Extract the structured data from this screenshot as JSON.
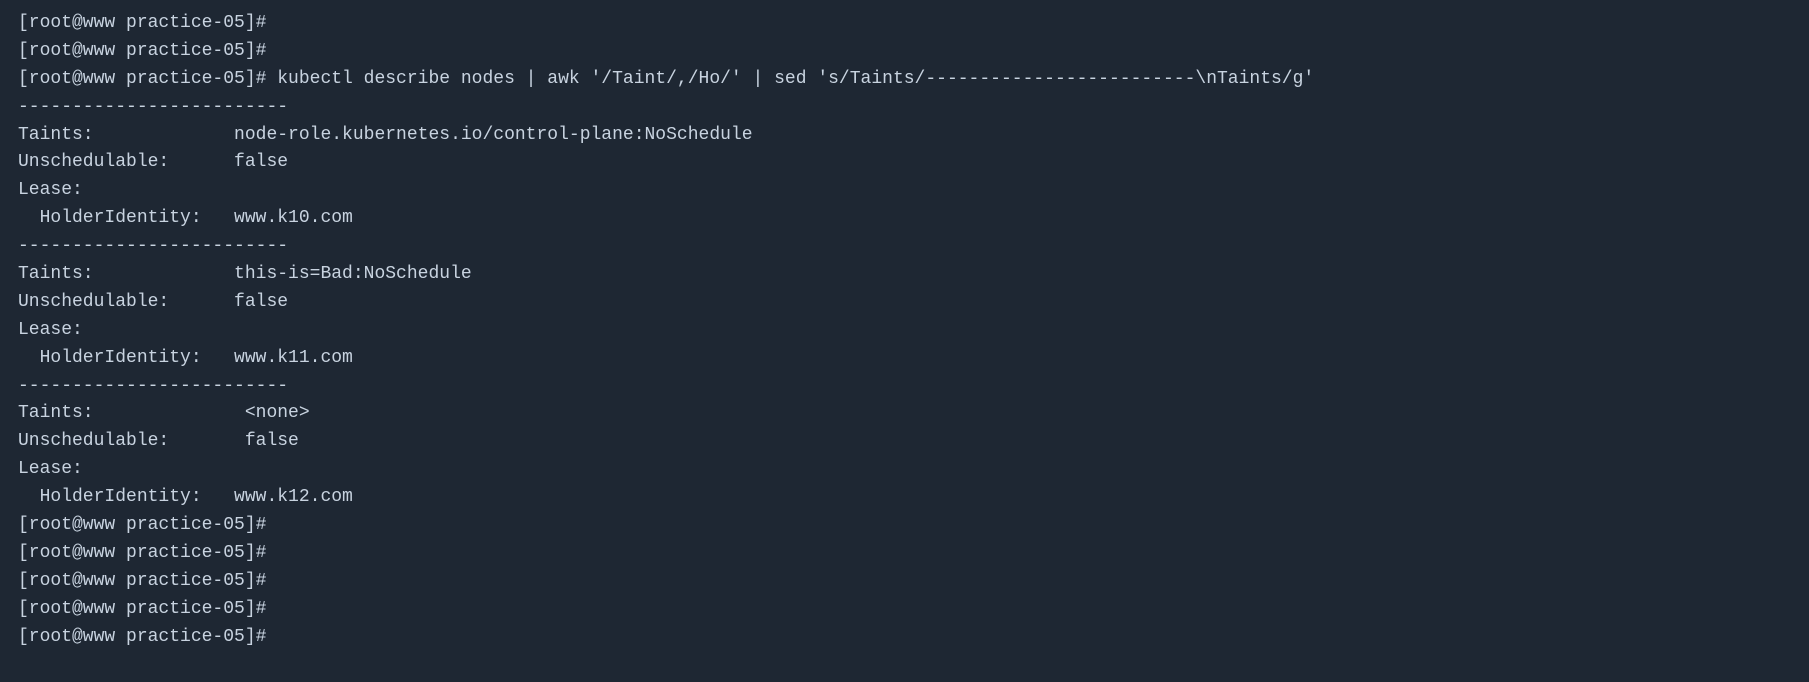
{
  "terminal": {
    "background": "#1e2733",
    "foreground": "#c8d3e0",
    "lines": [
      {
        "id": "line1",
        "text": "[root@www practice-05]#"
      },
      {
        "id": "line2",
        "text": "[root@www practice-05]#"
      },
      {
        "id": "line3",
        "text": "[root@www practice-05]# kubectl describe nodes | awk '/Taint/,/Ho/' | sed 's/Taints/-------------------------\\nTaints/g'"
      },
      {
        "id": "line4",
        "text": "-------------------------"
      },
      {
        "id": "line5",
        "text": "Taints:             node-role.kubernetes.io/control-plane:NoSchedule"
      },
      {
        "id": "line6",
        "text": "Unschedulable:      false"
      },
      {
        "id": "line7",
        "text": "Lease:"
      },
      {
        "id": "line8",
        "text": "  HolderIdentity:   www.k10.com"
      },
      {
        "id": "line9",
        "text": "-------------------------"
      },
      {
        "id": "line10",
        "text": "Taints:             this-is=Bad:NoSchedule"
      },
      {
        "id": "line11",
        "text": "Unschedulable:      false"
      },
      {
        "id": "line12",
        "text": "Lease:"
      },
      {
        "id": "line13",
        "text": "  HolderIdentity:   www.k11.com"
      },
      {
        "id": "line14",
        "text": "-------------------------"
      },
      {
        "id": "line15",
        "text": "Taints:              <none>"
      },
      {
        "id": "line16",
        "text": "Unschedulable:       false"
      },
      {
        "id": "line17",
        "text": "Lease:"
      },
      {
        "id": "line18",
        "text": "  HolderIdentity:   www.k12.com"
      },
      {
        "id": "line19",
        "text": "[root@www practice-05]#"
      },
      {
        "id": "line20",
        "text": "[root@www practice-05]#"
      },
      {
        "id": "line21",
        "text": "[root@www practice-05]#"
      },
      {
        "id": "line22",
        "text": "[root@www practice-05]#"
      },
      {
        "id": "line23",
        "text": "[root@www practice-05]#"
      }
    ]
  }
}
